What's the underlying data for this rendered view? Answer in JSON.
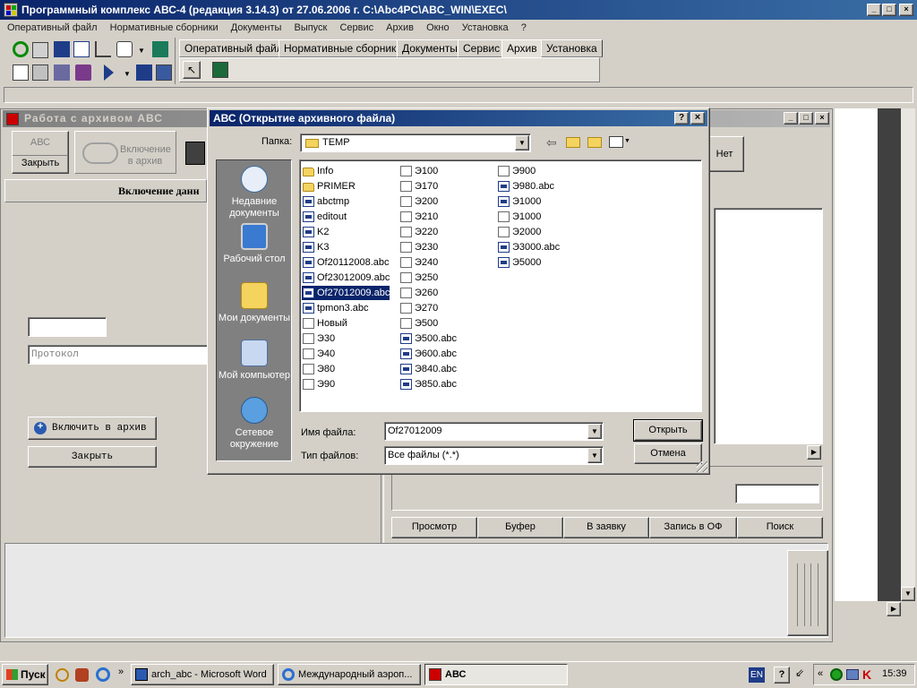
{
  "app": {
    "title": "Программный комплекс АВС-4 (редакция 3.14.3) от 27.06.2006 г.        C:\\Abc4PC\\ABC_WIN\\EXEC\\",
    "menu": [
      "Оперативный файл",
      "Нормативные сборники",
      "Документы",
      "Выпуск",
      "Сервис",
      "Архив",
      "Окно",
      "Установка",
      "?"
    ],
    "tabs": [
      "Оперативный файл",
      "Нормативные сборники",
      "Документы",
      "Сервис",
      "Архив",
      "Установка"
    ],
    "active_tab": "Архив",
    "caption_buttons": {
      "minimize": "_",
      "maximize": "□",
      "close": "×"
    }
  },
  "archive_window": {
    "title": "Работа с архивом АВС",
    "btn_abc": "АВС",
    "btn_close": "Закрыть",
    "btn_include": "Включение в архив",
    "btn_no": "Нет",
    "section_title": "Включение данн",
    "protocol_placeholder": "Протокол",
    "btn_include_archive": "Включить в архив",
    "btn_close2": "Закрыть",
    "bottom_buttons": [
      "Просмотр",
      "Буфер",
      "В заявку",
      "Запись в ОФ",
      "Поиск"
    ]
  },
  "dialog": {
    "title": "АВС (Открытие архивного файла)",
    "help": "?",
    "close": "×",
    "folder_label": "Папка:",
    "folder_value": "TEMP",
    "places": [
      {
        "label": "Недавние документы",
        "icon": "recent-documents-icon"
      },
      {
        "label": "Рабочий стол",
        "icon": "desktop-icon"
      },
      {
        "label": "Мои документы",
        "icon": "my-documents-icon"
      },
      {
        "label": "Мой компьютер",
        "icon": "my-computer-icon"
      },
      {
        "label": "Сетевое окружение",
        "icon": "network-icon"
      }
    ],
    "files_col1": [
      {
        "name": "Info",
        "type": "folder"
      },
      {
        "name": "PRIMER",
        "type": "folder"
      },
      {
        "name": "abctmp",
        "type": "abc"
      },
      {
        "name": "editout",
        "type": "abc"
      },
      {
        "name": "K2",
        "type": "abc"
      },
      {
        "name": "K3",
        "type": "abc"
      },
      {
        "name": "Of20112008.abc",
        "type": "abc"
      },
      {
        "name": "Of23012009.abc",
        "type": "abc"
      },
      {
        "name": "Of27012009.abc",
        "type": "abc",
        "selected": true
      },
      {
        "name": "tpmon3.abc",
        "type": "abc"
      },
      {
        "name": "Новый",
        "type": "doc"
      },
      {
        "name": "Э30",
        "type": "doc"
      },
      {
        "name": "Э40",
        "type": "doc"
      },
      {
        "name": "Э80",
        "type": "doc"
      },
      {
        "name": "Э90",
        "type": "doc"
      }
    ],
    "files_col2": [
      {
        "name": "Э100",
        "type": "doc"
      },
      {
        "name": "Э170",
        "type": "doc"
      },
      {
        "name": "Э200",
        "type": "doc"
      },
      {
        "name": "Э210",
        "type": "doc"
      },
      {
        "name": "Э220",
        "type": "doc"
      },
      {
        "name": "Э230",
        "type": "doc"
      },
      {
        "name": "Э240",
        "type": "doc"
      },
      {
        "name": "Э250",
        "type": "doc"
      },
      {
        "name": "Э260",
        "type": "doc"
      },
      {
        "name": "Э270",
        "type": "doc"
      },
      {
        "name": "Э500",
        "type": "doc"
      },
      {
        "name": "Э500.abc",
        "type": "abc"
      },
      {
        "name": "Э600.abc",
        "type": "abc"
      },
      {
        "name": "Э840.abc",
        "type": "abc"
      },
      {
        "name": "Э850.abc",
        "type": "abc"
      }
    ],
    "files_col3": [
      {
        "name": "Э900",
        "type": "doc"
      },
      {
        "name": "Э980.abc",
        "type": "abc"
      },
      {
        "name": "Э1000",
        "type": "abc"
      },
      {
        "name": "Э1000",
        "type": "doc"
      },
      {
        "name": "Э2000",
        "type": "doc"
      },
      {
        "name": "Э3000.abc",
        "type": "abc"
      },
      {
        "name": "Э5000",
        "type": "abc"
      }
    ],
    "filename_label": "Имя файла:",
    "filename_value": "Of27012009",
    "filetype_label": "Тип файлов:",
    "filetype_value": "Все файлы (*.*)",
    "open_button": "Открыть",
    "cancel_button": "Отмена"
  },
  "taskbar": {
    "start": "Пуск",
    "tasks": [
      "arch_abc - Microsoft Word",
      "Международный аэроп...",
      "АВС"
    ],
    "active_task": "АВС",
    "lang": "EN",
    "clock": "15:39"
  },
  "colors": {
    "titlebar": "#0a246a",
    "selection": "#0a246a",
    "face": "#d4d0c8",
    "places_bg": "#808080"
  }
}
